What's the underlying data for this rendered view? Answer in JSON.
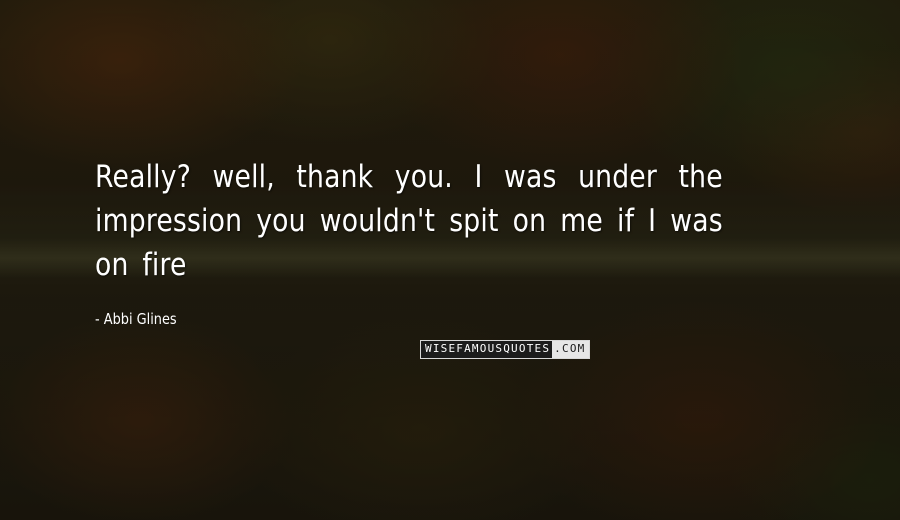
{
  "quote": {
    "text": "Really? well, thank you. I was under the impression you wouldn't spit on me if I was on fire",
    "author": "- Abbi Glines"
  },
  "watermark": {
    "part1": "WISEFAMOUSQUOTES",
    "part2": ".COM"
  },
  "colors": {
    "text": "#ffffff",
    "background": "#2b2312"
  }
}
